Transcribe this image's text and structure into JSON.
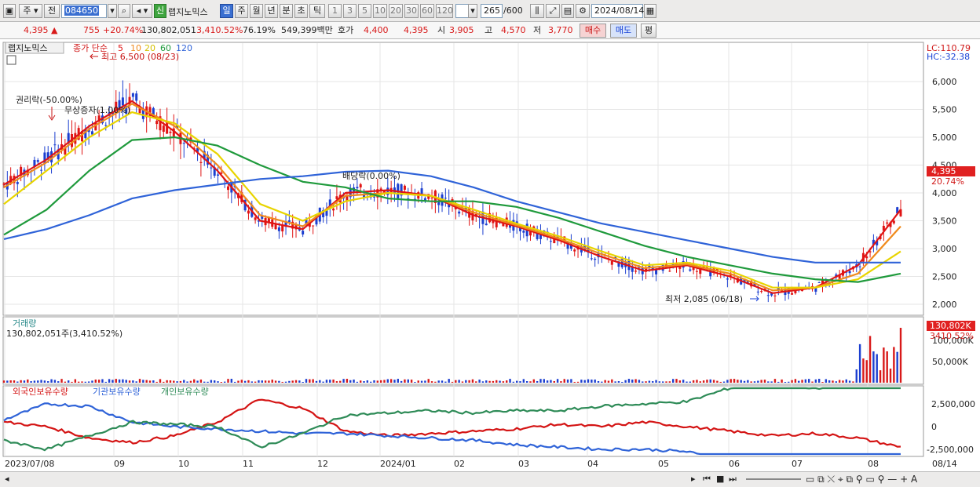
{
  "toolbar": {
    "market": "주",
    "scope": "전",
    "code": "084650",
    "badge": "신",
    "stock_name": "랩지노믹스",
    "periods": [
      "일",
      "주",
      "월",
      "년",
      "분",
      "초",
      "틱"
    ],
    "active_period": "일",
    "intervals": [
      "1",
      "3",
      "5",
      "10",
      "20",
      "30",
      "60",
      "120"
    ],
    "count": "265",
    "count_total": "/600",
    "date": "2024/08/14"
  },
  "quote": {
    "price": "4,395",
    "change": "755",
    "change_pct": "+20.74%",
    "volume": "130,802,051",
    "volume_pct": "3,410.52%",
    "ratio": "76.19%",
    "amount": "549,399백만",
    "bid_label": "호가",
    "bid": "4,400",
    "ask": "4,395",
    "open_label": "시",
    "open": "3,905",
    "high_label": "고",
    "high": "4,570",
    "low_label": "저",
    "low": "3,770",
    "buy_button": "매수",
    "sell_button": "매도",
    "avg_button": "평"
  },
  "price_panel": {
    "stock_tag": "랩지노믹스",
    "legend_prefix": "종가 단순",
    "ma_labels": [
      {
        "label": "5",
        "color": "#e01414"
      },
      {
        "label": "10",
        "color": "#f08a1c"
      },
      {
        "label": "20",
        "color": "#e8d400"
      },
      {
        "label": "60",
        "color": "#1f9a3c"
      },
      {
        "label": "120",
        "color": "#2f63d8"
      }
    ],
    "lc": "LC:110.79",
    "hc": "HC:-32.38",
    "high_note": "최고 6,500 (08/23)",
    "low_note": "최저 2,085 (06/18)",
    "event_rights": "권리락(-50.00%)",
    "event_bonus": "무상증자(1.00%)",
    "event_dividend": "배당락(0.00%)",
    "current_price": "4,395",
    "current_pct": "20.74%",
    "y_ticks": [
      "6,000",
      "5,500",
      "5,000",
      "4,500",
      "4,000",
      "3,500",
      "3,000",
      "2,500",
      "2,000"
    ]
  },
  "volume_panel": {
    "title": "거래량",
    "summary": "130,802,051주(3,410.52%)",
    "current": "130,802K",
    "current_pct": "3410.52%",
    "y_ticks": [
      "100,000K",
      "50,000K"
    ]
  },
  "holding_panel": {
    "legend": [
      {
        "label": "외국인보유수량",
        "color": "#d41414"
      },
      {
        "label": "기관보유수량",
        "color": "#2f63d8"
      },
      {
        "label": "개인보유수량",
        "color": "#2e8b57"
      }
    ],
    "y_ticks": [
      "2,500,000",
      "0",
      "-2,500,000"
    ]
  },
  "x_axis": {
    "ticks": [
      "2023/07/08",
      "09",
      "10",
      "11",
      "12",
      "2024/01",
      "02",
      "03",
      "04",
      "05",
      "06",
      "07",
      "08"
    ],
    "end_label": "08/14"
  },
  "chart_data": {
    "type": "line",
    "title": "",
    "price_range": [
      2000,
      6500
    ],
    "y_ticks": [
      6000,
      5500,
      5000,
      4500,
      4000,
      3500,
      3000,
      2500,
      2000
    ],
    "months": [
      "2023/07",
      "09",
      "10",
      "11",
      "12",
      "2024/01",
      "02",
      "03",
      "04",
      "05",
      "06",
      "07",
      "08"
    ],
    "series": [
      {
        "name": "5",
        "color": "#e01414",
        "values": [
          4150,
          4600,
          5200,
          5650,
          5100,
          4400,
          3500,
          3350,
          4000,
          4050,
          3950,
          3600,
          3400,
          3150,
          2850,
          2600,
          2700,
          2500,
          2200,
          2300,
          2700,
          3700
        ]
      },
      {
        "name": "10",
        "color": "#f08a1c",
        "values": [
          4100,
          4550,
          5150,
          5600,
          5200,
          4500,
          3600,
          3400,
          3950,
          4000,
          3950,
          3650,
          3420,
          3180,
          2900,
          2650,
          2720,
          2550,
          2250,
          2300,
          2550,
          3400
        ]
      },
      {
        "name": "20",
        "color": "#e8d400",
        "values": [
          3800,
          4400,
          5000,
          5450,
          5250,
          4700,
          3800,
          3500,
          3850,
          4000,
          3950,
          3700,
          3450,
          3220,
          2950,
          2700,
          2750,
          2600,
          2300,
          2300,
          2450,
          2950
        ]
      },
      {
        "name": "60",
        "color": "#1f9a3c",
        "values": [
          3250,
          3700,
          4400,
          4950,
          5000,
          4850,
          4500,
          4200,
          4100,
          3900,
          3850,
          3850,
          3750,
          3550,
          3300,
          3050,
          2850,
          2700,
          2550,
          2450,
          2400,
          2550
        ]
      },
      {
        "name": "120",
        "color": "#2f63d8",
        "values": [
          3170,
          3350,
          3600,
          3900,
          4050,
          4150,
          4250,
          4300,
          4380,
          4400,
          4300,
          4100,
          3850,
          3650,
          3450,
          3300,
          3150,
          3000,
          2850,
          2750,
          2750,
          2750
        ]
      }
    ]
  }
}
